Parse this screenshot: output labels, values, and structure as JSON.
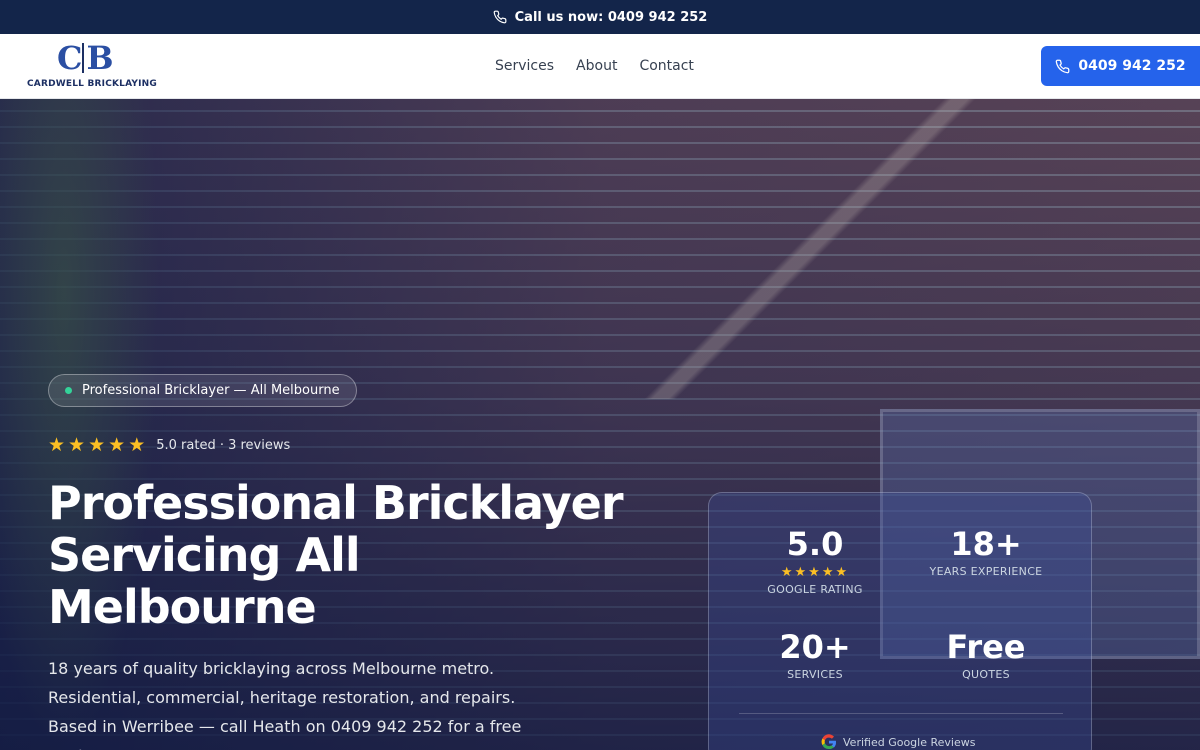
{
  "topbar": {
    "call_text": "Call us now: 0409 942 252"
  },
  "header": {
    "logo_mark": "CB",
    "logo_text": "CARDWELL BRICKLAYING",
    "nav": [
      "Services",
      "About",
      "Contact"
    ],
    "call_button": "0409 942 252"
  },
  "hero": {
    "badge": "Professional Bricklayer — All Melbourne",
    "rating_text": "5.0 rated · 3 reviews",
    "rating_stars": 5,
    "title_lines": [
      "Professional Bricklayer",
      "Servicing All",
      "Melbourne"
    ],
    "subtitle": "18 years of quality bricklaying across Melbourne metro. Residential, commercial, heritage restoration, and repairs. Based in Werribee — call Heath on 0409 942 252 for a free quote."
  },
  "stats": {
    "items": [
      {
        "value": "5.0",
        "label": "GOOGLE RATING"
      },
      {
        "value": "18+",
        "label": "YEARS EXPERIENCE"
      },
      {
        "value": "20+",
        "label": "SERVICES"
      },
      {
        "value": "Free",
        "label": "QUOTES"
      }
    ],
    "verified": "Verified Google Reviews"
  },
  "colors": {
    "navy": "#13254a",
    "accent": "#2563eb",
    "star": "#fbbf24",
    "badge_dot": "#34d399"
  }
}
